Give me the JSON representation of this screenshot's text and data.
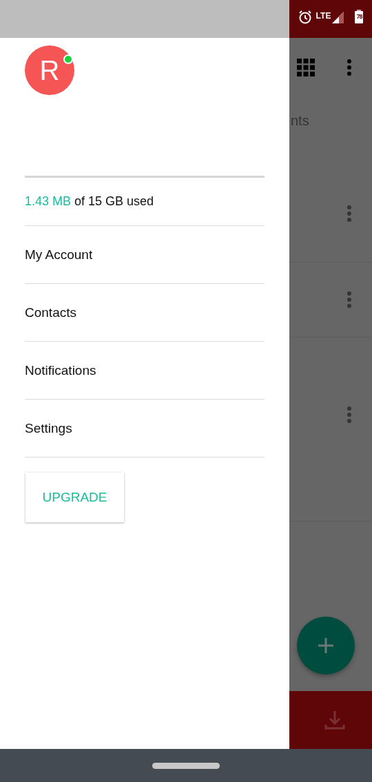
{
  "status_bar": {
    "network": "LTE",
    "battery": "78"
  },
  "drawer": {
    "avatar": {
      "initial": "R",
      "online": true
    },
    "storage": {
      "used": "1.43 MB",
      "total": "of 15 GB used"
    },
    "menu": [
      {
        "label": "My Account"
      },
      {
        "label": "Contacts"
      },
      {
        "label": "Notifications"
      },
      {
        "label": "Settings"
      }
    ],
    "upgrade_button": "UPGRADE"
  },
  "background": {
    "title_fragment": "nts",
    "rows": [
      {
        "kind": "item"
      },
      {
        "kind": "item"
      },
      {
        "kind": "item"
      }
    ]
  }
}
